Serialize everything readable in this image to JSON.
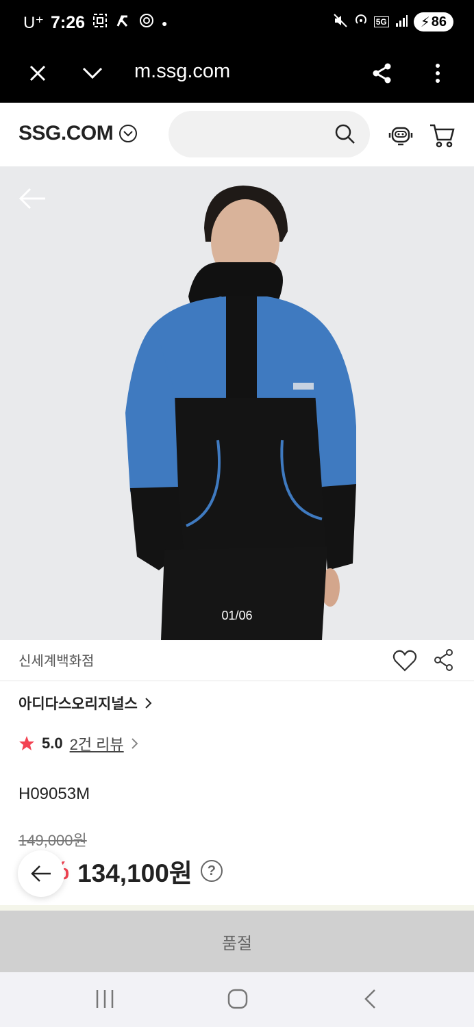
{
  "status_bar": {
    "carrier": "U⁺",
    "time": "7:26",
    "network": "5G",
    "battery": "86"
  },
  "browser": {
    "url": "m.ssg.com"
  },
  "header": {
    "logo": "SSG.COM",
    "search_placeholder": ""
  },
  "product": {
    "image_counter": "01/06",
    "seller": "신세계백화점",
    "brand": "아디다스오리지널스",
    "rating": "5.0",
    "reviews": "2건 리뷰",
    "model": "H09053M",
    "original_price": "149,000원",
    "discount": "10%",
    "price": "134,100원"
  },
  "cta": {
    "label": "품절"
  },
  "colors": {
    "accent": "#f34352",
    "star": "#f34352",
    "jacket_blue": "#3f7ac0"
  }
}
